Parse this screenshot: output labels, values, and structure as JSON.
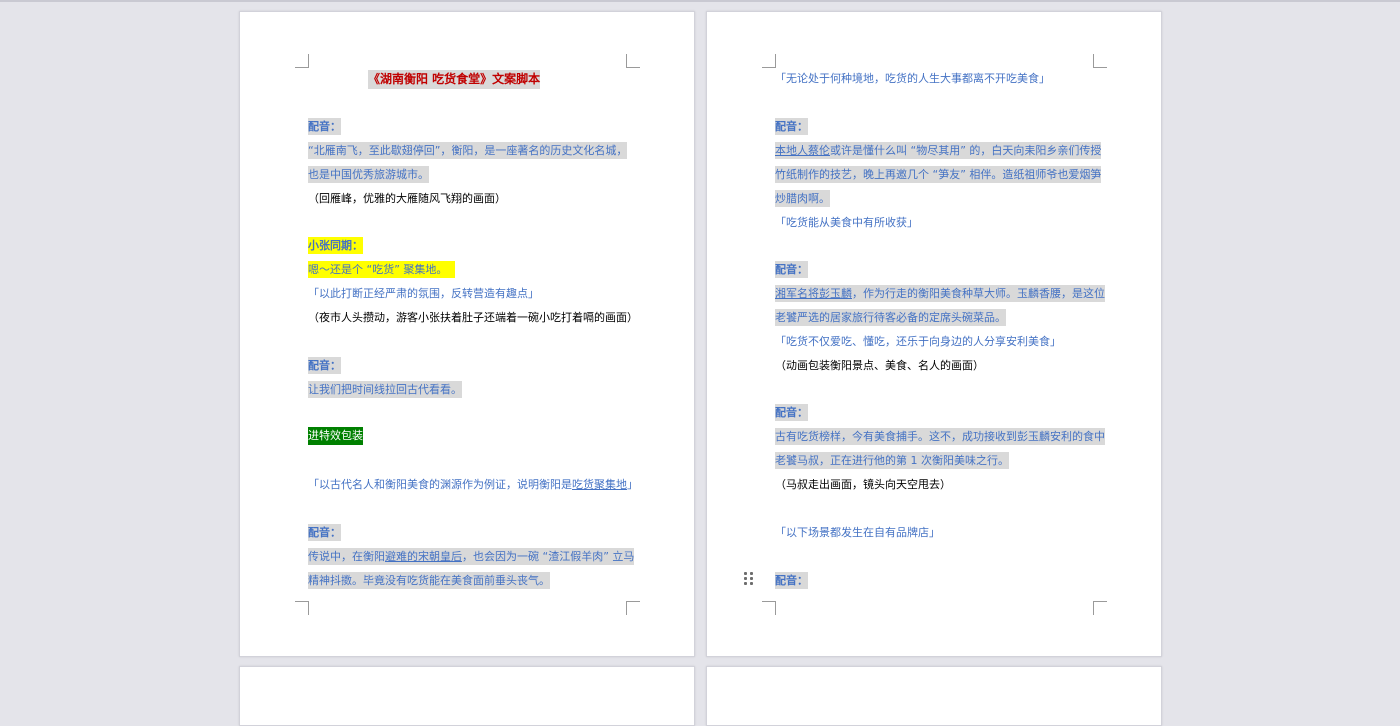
{
  "page1": {
    "title": "《湖南衡阳 吃货食堂》文案脚本",
    "lines": [
      "配音：",
      "“北雁南飞，至此歇翅停回”，衡阳，是一座著名的历史文化名城，",
      "也是中国优秀旅游城市。",
      "（回雁峰，优雅的大雁随风飞翔的画面）",
      "小张同期：",
      "嗯～还是个 “吃货” 聚集地。",
      "「以此打断正经严肃的氛围，反转营造有趣点」",
      "（夜市人头攒动，游客小张扶着肚子还端着一碗小吃打着嗝的画面）",
      "配音：",
      "让我们把时间线拉回古代看看。",
      "进特效包装",
      "「以古代名人和衡阳美食的渊源作为例证，说明衡阳是",
      "吃货聚集地",
      "」",
      "配音：",
      "传说中，在衡阳",
      "避难的宋朝皇后",
      "，也会因为一碗 “渣江假羊肉” 立马",
      "精神抖擞。毕竟没有吃货能在美食面前垂头丧气。"
    ]
  },
  "page2": {
    "lines": [
      "「无论处于何种境地，吃货的人生大事都离不开吃美食」",
      "配音：",
      "本地人蔡伦",
      "或许是懂什么叫 “物尽其用” 的，白天向耒阳乡亲们传授",
      "竹纸制作的技艺，晚上再邀几个 “笋友” 相伴。造纸祖师爷也爱烟笋",
      "炒腊肉啊。",
      "「吃货能从美食中有所收获」",
      "配音：",
      "湘军名将彭玉麟",
      "，作为行走的衡阳美食种草大师。玉麟香腰，是这位",
      "老饕严选的居家旅行待客必备的定席头碗菜品。",
      "「吃货不仅爱吃、懂吃，还乐于向身边的人分享安利美食」",
      "（动画包装衡阳景点、美食、名人的画面）",
      "配音：",
      "古有吃货榜样，今有美食捕手。这不，成功接收到彭玉麟安利的食中",
      "老饕马叔，正在进行他的第 1 次衡阳美味之行。",
      "（马叔走出画面，镜头向天空甩去）",
      "「以下场景都发生在自有品牌店」",
      "配音："
    ]
  },
  "colors": {
    "blue": "#4472c4",
    "red": "#c00000",
    "highlight_gray": "#d9d9d9",
    "highlight_yellow": "#ffff00",
    "highlight_green": "#008000"
  },
  "icons": {
    "drag_handle": "drag-handle-icon"
  }
}
